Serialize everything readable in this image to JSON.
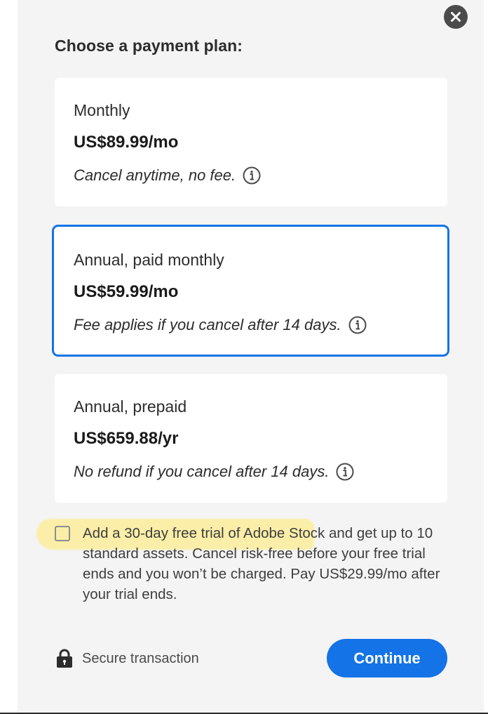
{
  "dialog": {
    "heading": "Choose a payment plan:",
    "close_label": "×"
  },
  "plans": [
    {
      "name": "Monthly",
      "price": "US$89.99/mo",
      "terms": "Cancel anytime, no fee.",
      "selected": false
    },
    {
      "name": "Annual, paid monthly",
      "price": "US$59.99/mo",
      "terms": "Fee applies if you cancel after 14 days.",
      "selected": true
    },
    {
      "name": "Annual, prepaid",
      "price": "US$659.88/yr",
      "terms": "No refund if you cancel after 14 days.",
      "selected": false
    }
  ],
  "stock_offer": {
    "checked": false,
    "text": "Add a 30-day free trial of Adobe Stock and get up to 10 standard assets. Cancel risk-free before your free trial ends and you won’t be charged. Pay US$29.99/mo after your trial ends."
  },
  "footer": {
    "secure_label": "Secure transaction",
    "continue_label": "Continue"
  },
  "icons": {
    "close": "close-icon",
    "info": "info-icon",
    "lock": "lock-icon"
  },
  "colors": {
    "accent": "#1473e6",
    "panel_background": "#f4f4f4",
    "highlight": "#fbeea4"
  }
}
